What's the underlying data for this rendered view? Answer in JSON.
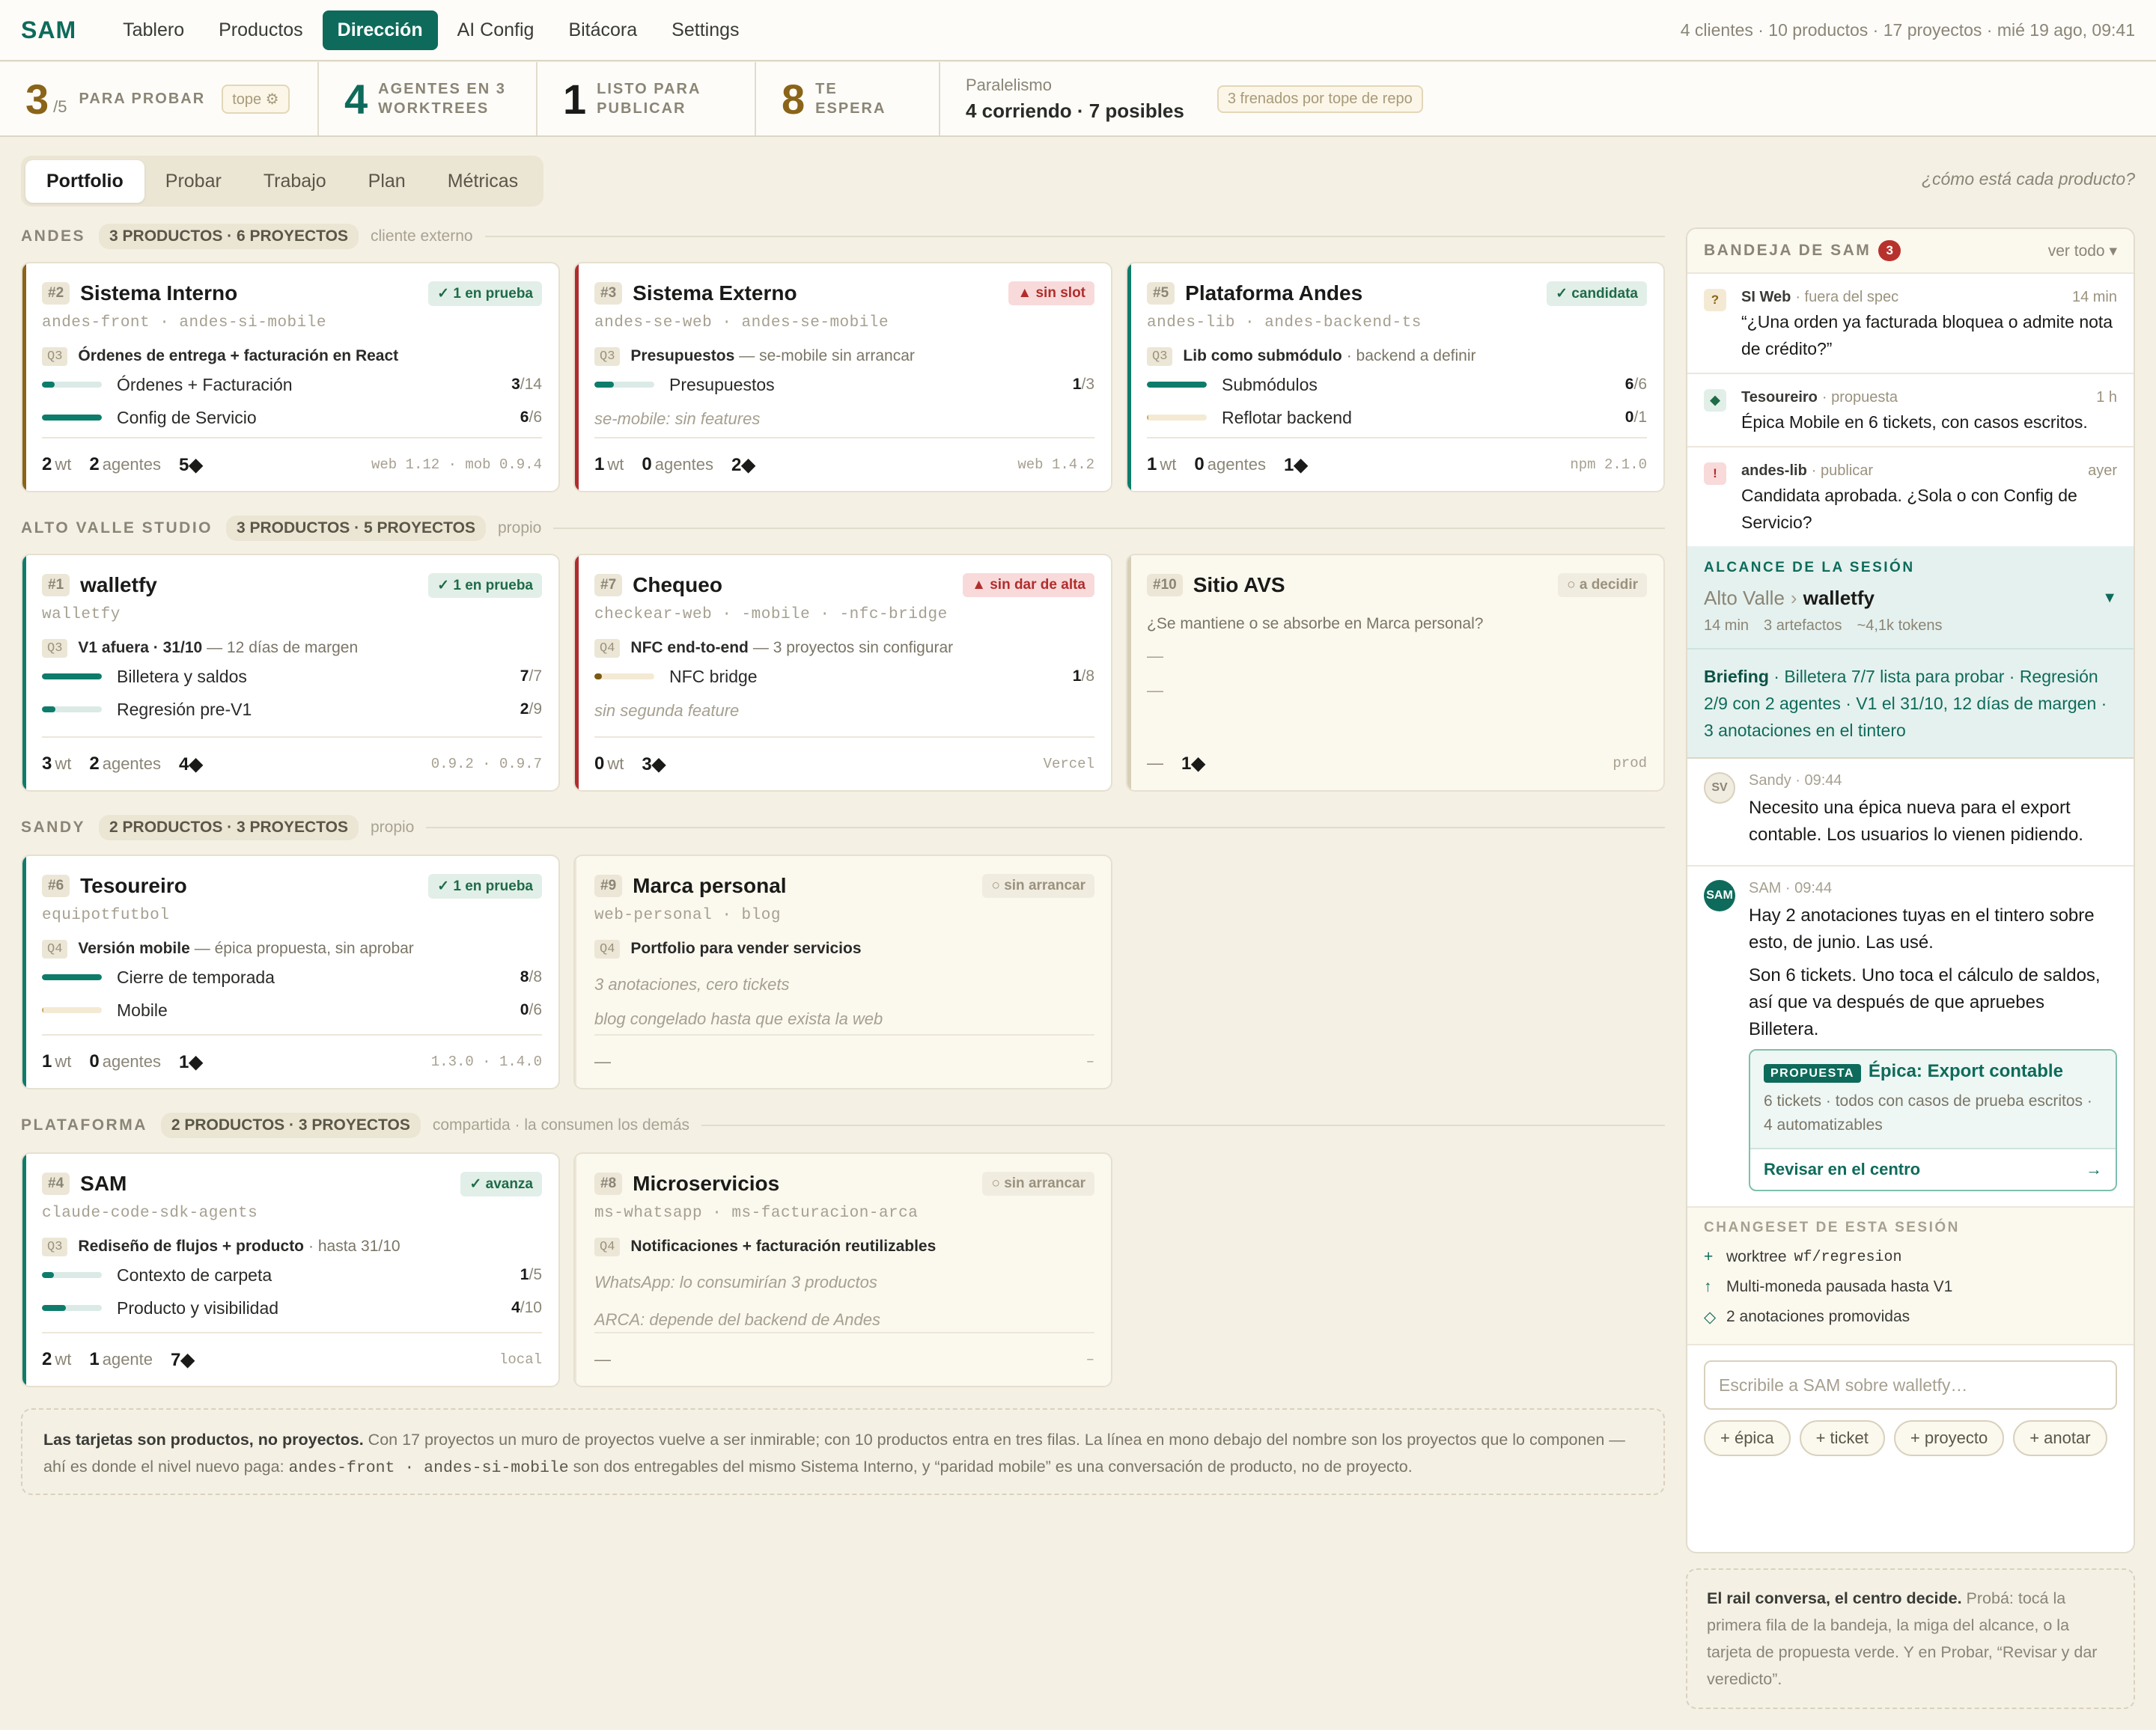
{
  "app": {
    "logo": "SAM",
    "meta": "4 clientes · 10 productos · 17 proyectos · mié 19 ago, 09:41"
  },
  "nav": [
    {
      "label": "Tablero"
    },
    {
      "label": "Productos"
    },
    {
      "label": "Dirección"
    },
    {
      "label": "AI Config"
    },
    {
      "label": "Bitácora"
    },
    {
      "label": "Settings"
    }
  ],
  "stats": {
    "probar": {
      "num": "3",
      "sub": "/5",
      "label": "PARA PROBAR",
      "pill": "tope ⚙"
    },
    "agentes": {
      "num": "4",
      "label1": "AGENTES EN 3",
      "label2": "WORKTREES"
    },
    "listo": {
      "num": "1",
      "label1": "LISTO PARA",
      "label2": "PUBLICAR"
    },
    "espera": {
      "num": "8",
      "label": "TE ESPERA"
    },
    "paralelismo": {
      "label": "Paralelismo",
      "value": "4 corriendo · 7 posibles",
      "pill": "3 frenados por tope de repo"
    }
  },
  "tabs": [
    {
      "label": "Portfolio"
    },
    {
      "label": "Probar"
    },
    {
      "label": "Trabajo"
    },
    {
      "label": "Plan"
    },
    {
      "label": "Métricas"
    }
  ],
  "hint": "¿cómo está cada producto?",
  "sections": [
    {
      "name": "ANDES",
      "pill": "3 PRODUCTOS · 6 PROYECTOS",
      "note": "cliente externo"
    },
    {
      "name": "ALTO VALLE STUDIO",
      "pill": "3 PRODUCTOS · 5 PROYECTOS",
      "note": "propio"
    },
    {
      "name": "SANDY",
      "pill": "2 PRODUCTOS · 3 PROYECTOS",
      "note": "propio"
    },
    {
      "name": "PLATAFORMA",
      "pill": "2 PRODUCTOS · 3 PROYECTOS",
      "note": "compartida · la consumen los demás"
    }
  ],
  "cards": [
    {
      "num": "#2",
      "title": "Sistema Interno",
      "badge": "✓ 1 en prueba",
      "repos": "andes-front · andes-si-mobile",
      "q": "Q3",
      "goal": "Órdenes de entrega + facturación en React",
      "goal_rest": "",
      "rows": [
        {
          "label": "Órdenes + Facturación",
          "done": "3",
          "total": "/14",
          "pct": 0.21
        },
        {
          "label": "Config de Servicio",
          "done": "6",
          "total": "/6",
          "pct": 1
        }
      ],
      "foot": {
        "wt": "2",
        "wt_u": "wt",
        "ag": "2",
        "ag_u": "agentes",
        "dia": "5◆",
        "ver": "web 1.12 · mob 0.9.4"
      }
    },
    {
      "num": "#3",
      "title": "Sistema Externo",
      "badge": "▲ sin slot",
      "repos": "andes-se-web · andes-se-mobile",
      "q": "Q3",
      "goal": "Presupuestos",
      "goal_rest": "— se-mobile sin arrancar",
      "rows": [
        {
          "label": "Presupuestos",
          "done": "1",
          "total": "/3",
          "pct": 0.33
        }
      ],
      "italic": "se-mobile: sin features",
      "foot": {
        "wt": "1",
        "wt_u": "wt",
        "ag": "0",
        "ag_u": "agentes",
        "dia": "2◆",
        "ver": "web 1.4.2"
      }
    },
    {
      "num": "#5",
      "title": "Plataforma Andes",
      "badge": "✓ candidata",
      "repos": "andes-lib · andes-backend-ts",
      "q": "Q3",
      "goal": "Lib como submódulo",
      "goal_rest": "· backend a definir",
      "rows": [
        {
          "label": "Submódulos",
          "done": "6",
          "total": "/6",
          "pct": 1
        },
        {
          "label": "Reflotar backend",
          "done": "0",
          "total": "/1",
          "pct": 0.02
        }
      ],
      "foot": {
        "wt": "1",
        "wt_u": "wt",
        "ag": "0",
        "ag_u": "agentes",
        "dia": "1◆",
        "ver": "npm 2.1.0"
      }
    },
    {
      "num": "#1",
      "title": "walletfy",
      "badge": "✓ 1 en prueba",
      "repos": "walletfy",
      "q": "Q3",
      "goal": "V1 afuera · 31/10",
      "goal_rest": "— 12 días de margen",
      "rows": [
        {
          "label": "Billetera y saldos",
          "done": "7",
          "total": "/7",
          "pct": 1
        },
        {
          "label": "Regresión pre-V1",
          "done": "2",
          "total": "/9",
          "pct": 0.22
        }
      ],
      "foot": {
        "wt": "3",
        "wt_u": "wt",
        "ag": "2",
        "ag_u": "agentes",
        "dia": "4◆",
        "ver": "0.9.2 · 0.9.7"
      }
    },
    {
      "num": "#7",
      "title": "Chequeo",
      "badge": "▲ sin dar de alta",
      "repos": "checkear-web · -mobile · -nfc-bridge",
      "q": "Q4",
      "goal": "NFC end-to-end",
      "goal_rest": "— 3 proyectos sin configurar",
      "rows": [
        {
          "label": "NFC bridge",
          "done": "1",
          "total": "/8",
          "pct": 0.125
        }
      ],
      "italic": "sin segunda feature",
      "foot": {
        "wt": "0",
        "wt_u": "wt",
        "dia": "3◆",
        "ver": "Vercel"
      }
    },
    {
      "num": "#10",
      "title": "Sitio AVS",
      "badge": "○ a decidir",
      "question": "¿Se mantiene o se absorbe en Marca personal?",
      "dash1": "—",
      "dash2": "—",
      "foot": {
        "pre": "—",
        "dia": "1◆",
        "ver": "prod"
      }
    },
    {
      "num": "#6",
      "title": "Tesoureiro",
      "badge": "✓ 1 en prueba",
      "repos": "equipotfutbol",
      "q": "Q4",
      "goal": "Versión mobile",
      "goal_rest": "— épica propuesta, sin aprobar",
      "rows": [
        {
          "label": "Cierre de temporada",
          "done": "8",
          "total": "/8",
          "pct": 1
        },
        {
          "label": "Mobile",
          "done": "0",
          "total": "/6",
          "pct": 0.02
        }
      ],
      "foot": {
        "wt": "1",
        "wt_u": "wt",
        "ag": "0",
        "ag_u": "agentes",
        "dia": "1◆",
        "ver": "1.3.0 · 1.4.0"
      }
    },
    {
      "num": "#9",
      "title": "Marca personal",
      "badge": "○ sin arrancar",
      "repos": "web-personal · blog",
      "q": "Q4",
      "goal": "Portfolio para vender servicios",
      "goal_rest": "",
      "italic1": "3 anotaciones, cero tickets",
      "italic2": "blog congelado hasta que exista la web",
      "foot": {
        "pre": "—",
        "ver": "–"
      }
    },
    {
      "num": "#4",
      "title": "SAM",
      "badge": "✓ avanza",
      "repos": "claude-code-sdk-agents",
      "q": "Q3",
      "goal": "Rediseño de flujos + producto",
      "goal_rest": "· hasta 31/10",
      "rows": [
        {
          "label": "Contexto de carpeta",
          "done": "1",
          "total": "/5",
          "pct": 0.2
        },
        {
          "label": "Producto y visibilidad",
          "done": "4",
          "total": "/10",
          "pct": 0.4
        }
      ],
      "foot": {
        "wt": "2",
        "wt_u": "wt",
        "ag": "1",
        "ag_u": "agente",
        "dia": "7◆",
        "ver": "local"
      }
    },
    {
      "num": "#8",
      "title": "Microservicios",
      "badge": "○ sin arrancar",
      "repos": "ms-whatsapp · ms-facturacion-arca",
      "q": "Q4",
      "goal": "Notificaciones + facturación reutilizables",
      "goal_rest": "",
      "italic1": "WhatsApp: lo consumirían 3 productos",
      "italic2": "ARCA: depende del backend de Andes",
      "foot": {
        "pre": "—",
        "ver": "–"
      }
    }
  ],
  "note": {
    "bold": "Las tarjetas son productos, no proyectos.",
    "t1": " Con 17 proyectos un muro de proyectos vuelve a ser inmirable; con 10 productos entra en tres filas. La línea en mono debajo del nombre son los proyectos que lo componen — ahí es donde el nivel nuevo paga: ",
    "c1": "andes-front · andes-si-mobile",
    "t2": " son dos entregables del mismo Sistema Interno, y “paridad mobile” es una conversación de producto, no de proyecto."
  },
  "sidebar": {
    "title": "BANDEJA DE SAM",
    "count": "3",
    "view_all": "ver todo ▾",
    "inbox": [
      {
        "icon": "?",
        "from": "SI Web",
        "tag": "· fuera del spec",
        "time": "14 min",
        "text": "“¿Una orden ya facturada bloquea o admite nota de crédito?”"
      },
      {
        "icon": "◆",
        "from": "Tesoureiro",
        "tag": "· propuesta",
        "time": "1 h",
        "text": "Épica Mobile en 6 tickets, con casos escritos."
      },
      {
        "icon": "!",
        "from": "andes-lib",
        "tag": "· publicar",
        "time": "ayer",
        "text": "Candidata aprobada. ¿Sola o con Config de Servicio?"
      }
    ],
    "scope": {
      "title": "ALCANCE DE LA SESIÓN",
      "parent": "Alto Valle",
      "sep": "›",
      "current": "walletfy",
      "chev": "▼",
      "m1": "14 min",
      "m2": "3 artefactos",
      "m3": "~4,1k tokens"
    },
    "brief": {
      "bold": "Briefing",
      "text": " · Billetera 7/7 lista para probar · Regresión 2/9 con 2 agentes · V1 el 31/10, 12 días de margen · 3 anotaciones en el tintero"
    },
    "msgs": [
      {
        "av": "SV",
        "head": "Sandy · 09:44",
        "text": "Necesito una épica nueva para el export contable. Los usuarios lo vienen pidiendo."
      },
      {
        "av": "SAM",
        "head": "SAM · 09:44",
        "text1": "Hay 2 anotaciones tuyas en el tintero sobre esto, de junio. Las usé.",
        "text2": "Son 6 tickets. Uno toca el cálculo de saldos, así que va después de que apruebes Billetera."
      }
    ],
    "proposal": {
      "tag": "PROPUESTA",
      "title": "Épica: Export contable",
      "desc": "6 tickets · todos con casos de prueba escritos · 4 automatizables",
      "action": "Revisar en el centro",
      "arrow": "→"
    },
    "changeset": {
      "title": "CHANGESET DE ESTA SESIÓN",
      "items": [
        {
          "g": "+",
          "t": "worktree",
          "code": "wf/regresion"
        },
        {
          "g": "↑",
          "t": "Multi-moneda pausada hasta V1"
        },
        {
          "g": "◇",
          "t": "2 anotaciones promovidas"
        }
      ]
    },
    "composer": {
      "placeholder": "Escribile a SAM sobre walletfy…",
      "chips": [
        "+ épica",
        "+ ticket",
        "+ proyecto",
        "+ anotar"
      ]
    },
    "note": {
      "bold": "El rail conversa, el centro decide.",
      "text": " Probá: tocá la primera fila de la bandeja, la miga del alcance, o la tarjeta de propuesta verde. Y en Probar, “Revisar y dar veredicto”."
    }
  },
  "colors": {
    "accent": "#0e6b5b",
    "gold": "#8a6418",
    "red": "#b12d2d",
    "tan": "#d8cfb7"
  }
}
